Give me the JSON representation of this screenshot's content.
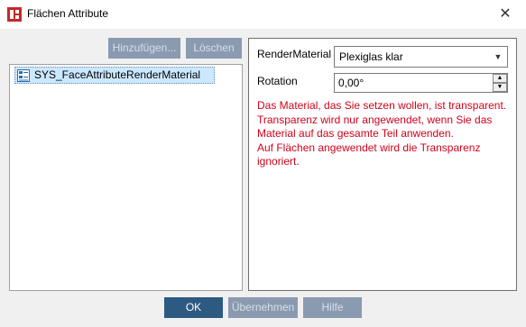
{
  "window": {
    "title": "Flächen Attribute",
    "close_glyph": "✕",
    "icon": "app-icon"
  },
  "toolbar": {
    "add_label": "Hinzufügen...",
    "delete_label": "Löschen"
  },
  "tree": {
    "items": [
      {
        "label": "SYS_FaceAttributeRenderMaterial",
        "icon": "attribute-icon",
        "selected": true
      }
    ]
  },
  "properties": {
    "render_material": {
      "label": "RenderMaterial",
      "value": "Plexiglas klar"
    },
    "rotation": {
      "label": "Rotation",
      "value": "0,00°"
    },
    "warning_lines": [
      "Das Material, das Sie setzen wollen, ist transparent.",
      "Transparenz wird nur angewendet, wenn Sie das",
      "Material auf das gesamte Teil anwenden.",
      "Auf Flächen angewendet wird die Transparenz",
      "ignoriert."
    ],
    "warning_color": "#d0021b"
  },
  "footer": {
    "ok_label": "OK",
    "apply_label": "Übernehmen",
    "help_label": "Hilfe"
  },
  "colors": {
    "primary_button": "#2d5a80",
    "disabled_button": "#8a9bb1",
    "selection": "#cce8ff"
  }
}
